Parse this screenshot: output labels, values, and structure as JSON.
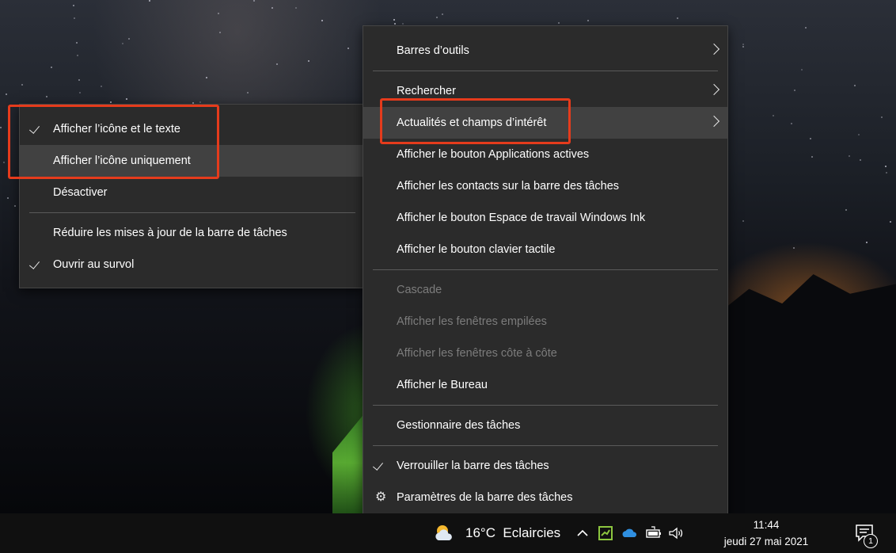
{
  "main_menu": {
    "items": [
      {
        "label": "Barres d’outils",
        "submenu": true
      },
      {
        "label": "Rechercher",
        "submenu": true
      },
      {
        "label": "Actualités et champs d’intérêt",
        "submenu": true,
        "highlighted": true
      },
      {
        "label": "Afficher le bouton Applications actives"
      },
      {
        "label": "Afficher les contacts sur la barre des tâches"
      },
      {
        "label": "Afficher le bouton Espace de travail Windows Ink"
      },
      {
        "label": "Afficher le bouton clavier tactile"
      },
      {
        "label": "Cascade",
        "disabled": true
      },
      {
        "label": "Afficher les fenêtres empilées",
        "disabled": true
      },
      {
        "label": "Afficher les fenêtres côte à côte",
        "disabled": true
      },
      {
        "label": "Afficher le Bureau"
      },
      {
        "label": "Gestionnaire des tâches"
      },
      {
        "label": "Verrouiller la barre des tâches",
        "checked": true
      },
      {
        "label": "Paramètres de la barre des tâches",
        "icon": "gear-icon"
      }
    ]
  },
  "sub_menu": {
    "items": [
      {
        "label": "Afficher l’icône et le texte",
        "checked": true
      },
      {
        "label": "Afficher l’icône uniquement",
        "highlighted": true
      },
      {
        "label": "Désactiver"
      },
      {
        "label": "Réduire les mises à jour de la barre de tâches"
      },
      {
        "label": "Ouvrir au survol",
        "checked": true
      }
    ]
  },
  "taskbar": {
    "weather_text": "16°C  Eclaircies",
    "clock_time": "11:44",
    "clock_date": "jeudi 27 mai 2021",
    "notification_count": "1",
    "tray_icons": [
      "chevron-up-icon",
      "app-tray-icon",
      "onedrive-cloud-icon",
      "battery-icon",
      "volume-icon"
    ]
  },
  "colors": {
    "menu_bg": "#2b2b2b",
    "highlight_bg": "#414141",
    "disabled_text": "#7c7c7c",
    "annotation_red": "#e53b1c",
    "taskbar_bg": "#101010"
  }
}
